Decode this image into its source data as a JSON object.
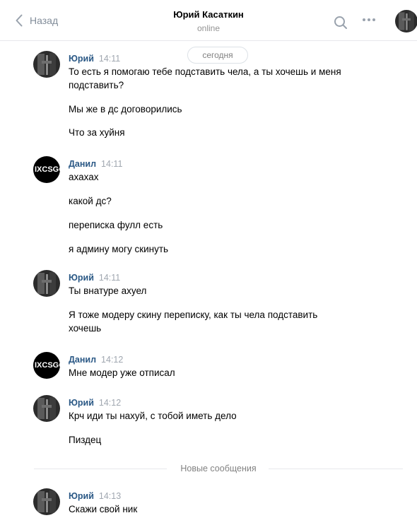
{
  "header": {
    "back_label": "Назад",
    "title": "Юрий Касаткин",
    "status": "online"
  },
  "date_divider": "сегодня",
  "avatars": {
    "danil_text": "IXCSGO"
  },
  "messages": [
    {
      "author": "Юрий",
      "time": "14:11",
      "lines": [
        "То есть я помогаю тебе подставить чела, а ты хочешь и меня подставить?",
        "Мы же в дс договорились",
        "Что за хуйня"
      ]
    },
    {
      "author": "Данил",
      "time": "14:11",
      "lines": [
        "ахахах",
        "какой дс?",
        "переписка фулл есть",
        "я админу могу скинуть"
      ]
    },
    {
      "author": "Юрий",
      "time": "14:11",
      "lines": [
        "Ты внатуре ахуел",
        "Я тоже модеру скину переписку, как ты чела подставить хочешь"
      ]
    },
    {
      "author": "Данил",
      "time": "14:12",
      "lines": [
        "Мне модер уже отписал"
      ]
    },
    {
      "author": "Юрий",
      "time": "14:12",
      "lines": [
        "Крч иди ты нахуй, с тобой иметь дело",
        "Пиздец"
      ]
    },
    {
      "author": "Юрий",
      "time": "14:13",
      "lines": [
        "Скажи свой ник"
      ]
    }
  ],
  "new_messages_divider": "Новые сообщения"
}
